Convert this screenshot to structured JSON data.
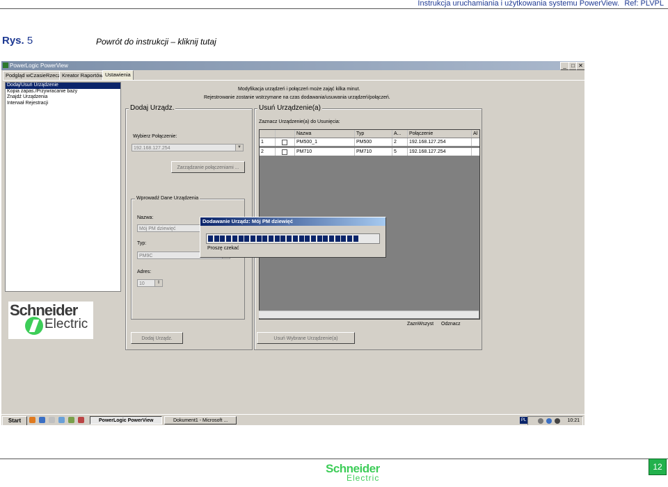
{
  "header": {
    "title": "Instrukcja uruchamiania i użytkowania systemu PowerView.",
    "ref": "Ref: PLVPL"
  },
  "figure": {
    "label": "Rys.",
    "number": "5",
    "back_link": "Powrót do instrukcji – kliknij tutaj"
  },
  "app": {
    "window_title": "PowerLogic PowerView",
    "window_buttons": [
      "_",
      "□",
      "✕"
    ],
    "tabs": [
      "Podgląd wCzasieRzecz",
      "Kreator Raportów",
      "Ustawienia"
    ],
    "active_tab": "Ustawienia",
    "sidebar_items": [
      "Dodaj/Usuń Urządzenie",
      "Kopia zapas./Przywracanie bazy",
      "Znajdź Urządzenia",
      "Interwał Rejestracji"
    ],
    "info_line1": "Modyfikacja urządzeń i połączeń może zająć kilka minut.",
    "info_line2": "Rejestrowanie zostanie wstrzymane na czas dodawania/usuwania urządzeń/połączeń.",
    "add": {
      "legend": "Dodaj Urządz.",
      "connection_label": "Wybierz Połączenie:",
      "connection_value": "192.168.127.254",
      "manage_button": "Zarządzanie połączeniami ...",
      "data_legend": "Wprowadź Dane Urządzenia",
      "name_label": "Nazwa:",
      "name_value": "Mój PM dziewięć",
      "type_label": "Typ:",
      "type_value": "PM9C",
      "address_label": "Adres:",
      "address_value": "10",
      "add_button": "Dodaj Urządz."
    },
    "remove": {
      "legend": "Usuń Urządzenie(a)",
      "select_label": "Zaznacz Urządzenie(a) do Usunięcia:",
      "columns": [
        "",
        "",
        "Nazwa",
        "Typ",
        "A...",
        "Połączenie",
        "Al"
      ],
      "rows": [
        {
          "num": "1",
          "name": "PM500_1",
          "type": "PM500",
          "addr": "2",
          "conn": "192.168.127.254"
        },
        {
          "num": "2",
          "name": "PM710",
          "type": "PM710",
          "addr": "5",
          "conn": "192.168.127.254"
        }
      ],
      "select_all": "ZaznWszyst",
      "deselect": "Odznacz",
      "remove_button": "Usuń Wybrane Urządzenie(a)"
    },
    "dialog": {
      "title": "Dodawanie Urządz: Mój PM dziewięć",
      "message": "Proszę czekać",
      "progress": 0.9
    },
    "logo": {
      "word1": "Schneider",
      "word2": "Electric"
    }
  },
  "taskbar": {
    "start": "Start",
    "tasks": [
      "PowerLogic PowerView",
      "Dokument1 - Microsoft ..."
    ],
    "lang": "PL",
    "clock": "10:21"
  },
  "footer": {
    "logo_word1": "Schneider",
    "logo_word2": "Electric",
    "page": "12"
  },
  "colors": {
    "accent_blue": "#1f3a93",
    "brand_green": "#3dcd58",
    "title_blue": "#0a246a",
    "page_badge": "#22b14c"
  }
}
